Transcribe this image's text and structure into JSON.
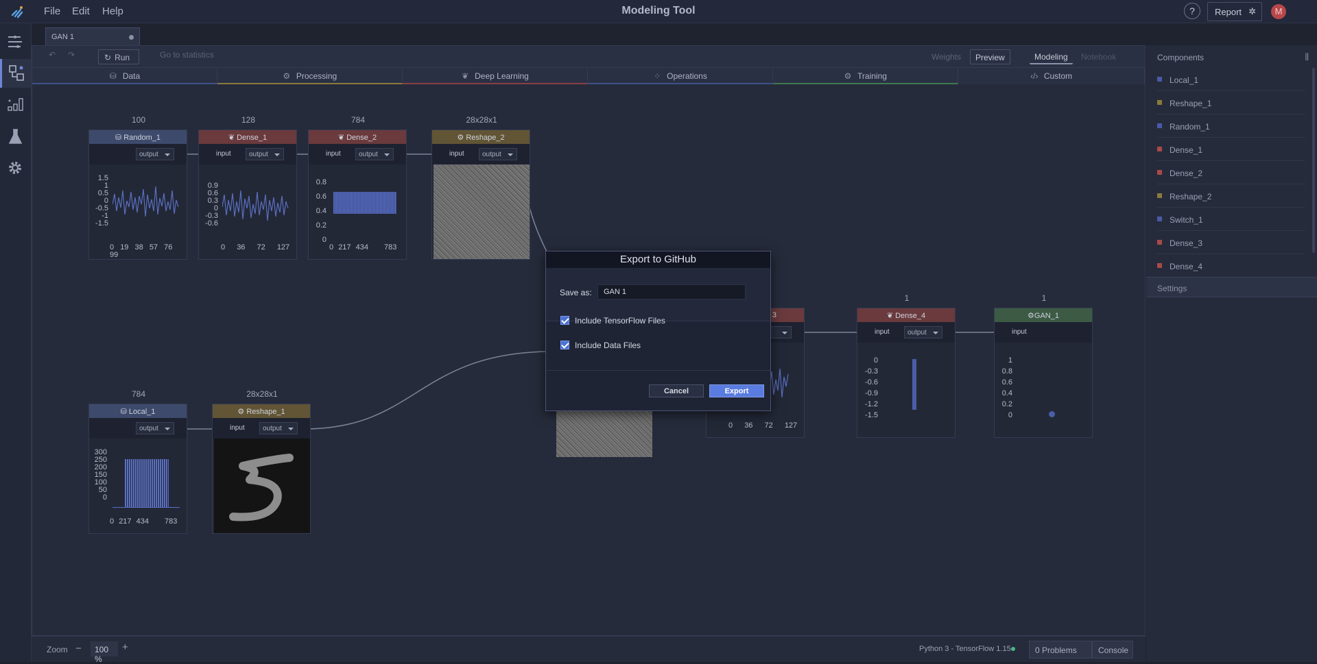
{
  "app": {
    "title": "Modeling Tool",
    "menu": [
      "File",
      "Edit",
      "Help"
    ],
    "help_label": "?",
    "report_label": "Report",
    "avatar_initial": "M"
  },
  "document_tab": {
    "label": "GAN 1"
  },
  "toolbar": {
    "run_label": "Run",
    "statistics_label": "Go to statistics",
    "weights_label": "Weights",
    "preview_label": "Preview",
    "modeling_label": "Modeling",
    "notebook_label": "Notebook"
  },
  "categories": [
    {
      "label": "Data",
      "icon": "database-icon",
      "color": "#3d5288"
    },
    {
      "label": "Processing",
      "icon": "gear-icon",
      "color": "#8a7a3c"
    },
    {
      "label": "Deep Learning",
      "icon": "brain-icon",
      "color": "#8b3f44"
    },
    {
      "label": "Operations",
      "icon": "grid-icon",
      "color": "#3d5288"
    },
    {
      "label": "Training",
      "icon": "gear-icon",
      "color": "#3f7a4f"
    },
    {
      "label": "Custom",
      "icon": "code-icon",
      "color": "#2b3043"
    }
  ],
  "nodes": {
    "random_1": {
      "dim": "100",
      "name": "Random_1",
      "out": "output",
      "y": [
        "1.5",
        "1",
        "0.5",
        "0",
        "-0.5",
        "-1",
        "-1.5"
      ],
      "x": [
        "0",
        "19",
        "38",
        "57",
        "76",
        "99"
      ]
    },
    "dense_1": {
      "dim": "128",
      "name": "Dense_1",
      "in": "input",
      "out": "output",
      "y": [
        "0.9",
        "0.6",
        "0.3",
        "0",
        "-0.3",
        "-0.6"
      ],
      "x": [
        "0",
        "36",
        "72",
        "127"
      ]
    },
    "dense_2": {
      "dim": "784",
      "name": "Dense_2",
      "in": "input",
      "out": "output",
      "y": [
        "0.8",
        "0.6",
        "0.4",
        "0.2",
        "0"
      ],
      "x": [
        "0",
        "217",
        "434",
        "783"
      ]
    },
    "reshape_2": {
      "dim": "28x28x1",
      "name": "Reshape_2",
      "in": "input",
      "out": "output"
    },
    "local_1": {
      "dim": "784",
      "name": "Local_1",
      "out": "output",
      "y": [
        "300",
        "250",
        "200",
        "150",
        "100",
        "50",
        "0"
      ],
      "x": [
        "0",
        "217",
        "434",
        "783"
      ]
    },
    "reshape_1": {
      "dim": "28x28x1",
      "name": "Reshape_1",
      "in": "input",
      "out": "output"
    },
    "dense_3": {
      "name_partial": "3",
      "x": [
        "0",
        "36",
        "72",
        "127"
      ]
    },
    "dense_4": {
      "dim": "1",
      "name": "Dense_4",
      "in": "input",
      "out": "output",
      "y": [
        "0",
        "-0.3",
        "-0.6",
        "-0.9",
        "-1.2",
        "-1.5"
      ]
    },
    "gan_1": {
      "dim": "1",
      "name": "GAN_1",
      "in": "input",
      "y": [
        "1",
        "0.8",
        "0.6",
        "0.4",
        "0.2",
        "0"
      ]
    }
  },
  "components_panel": {
    "title": "Components",
    "items": [
      {
        "label": "Local_1",
        "color": "#4a5aa8"
      },
      {
        "label": "Reshape_1",
        "color": "#8a7a3c"
      },
      {
        "label": "Random_1",
        "color": "#4a5aa8"
      },
      {
        "label": "Dense_1",
        "color": "#a84a4a"
      },
      {
        "label": "Dense_2",
        "color": "#a84a4a"
      },
      {
        "label": "Reshape_2",
        "color": "#8a7a3c"
      },
      {
        "label": "Switch_1",
        "color": "#4a5aa8"
      },
      {
        "label": "Dense_3",
        "color": "#a84a4a"
      },
      {
        "label": "Dense_4",
        "color": "#a84a4a"
      }
    ],
    "settings_label": "Settings"
  },
  "statusbar": {
    "zoom_label": "Zoom",
    "zoom_value": "100 %",
    "minus": "−",
    "plus": "+",
    "kernel": "Python 3 - TensorFlow 1.15",
    "problems": "0 Problems",
    "console": "Console"
  },
  "export_dialog": {
    "title": "Export to GitHub",
    "save_as_label": "Save as:",
    "save_as_value": "GAN 1",
    "include_tf": "Include TensorFlow Files",
    "include_data": "Include Data Files",
    "cancel": "Cancel",
    "export": "Export"
  }
}
